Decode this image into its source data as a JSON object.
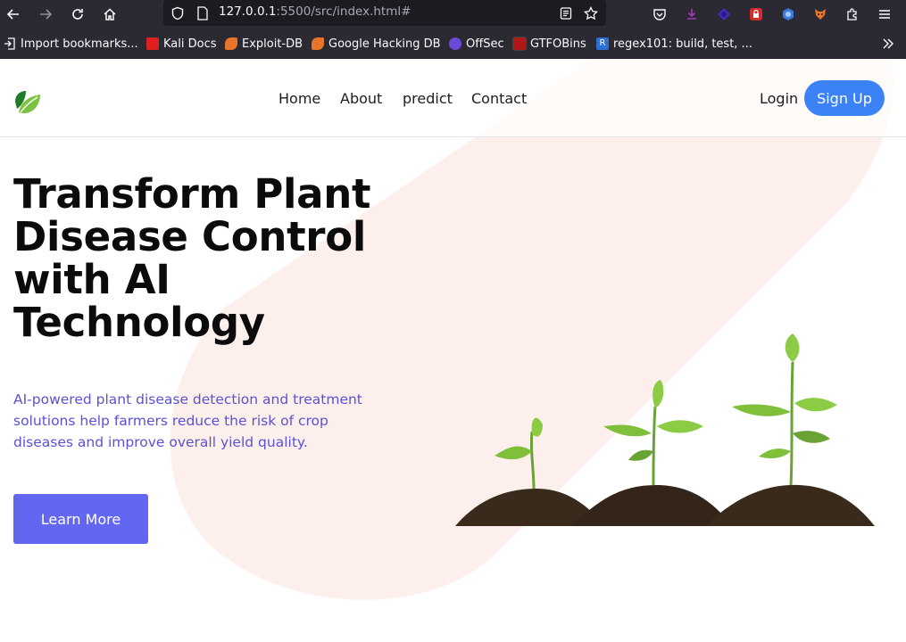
{
  "browser": {
    "url_host": "127.0.0.1",
    "url_rest": ":5500/src/index.html#",
    "bookmarks": [
      {
        "label": "Import bookmarks...",
        "color": "#fbfbfe"
      },
      {
        "label": "Kali Docs",
        "color": "#e02020"
      },
      {
        "label": "Exploit-DB",
        "color": "#e8742a"
      },
      {
        "label": "Google Hacking DB",
        "color": "#e8742a"
      },
      {
        "label": "OffSec",
        "color": "#6a4ad8"
      },
      {
        "label": "GTFOBins",
        "color": "#b01818"
      },
      {
        "label": "regex101: build, test, ...",
        "color": "#2d6ed1"
      }
    ]
  },
  "nav": {
    "links": [
      "Home",
      "About",
      "predict",
      "Contact"
    ],
    "login": "Login",
    "signup": "Sign Up"
  },
  "hero": {
    "title": "Transform Plant Disease Control with AI Technology",
    "subtitle": "AI-powered plant disease detection and treatment solutions help farmers reduce the risk of crop diseases and improve overall yield quality.",
    "cta": "Learn More"
  },
  "colors": {
    "accent": "#6366f1",
    "signup": "#3b82f6",
    "blob": "#fdf0ec",
    "subtitle": "#5a52d5"
  }
}
